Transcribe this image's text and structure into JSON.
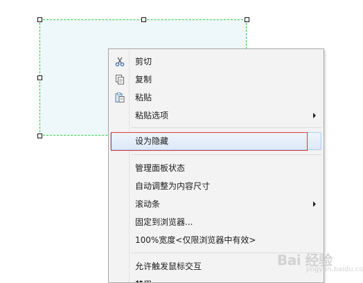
{
  "menu": {
    "items": [
      {
        "label": "剪切",
        "icon": "scissors-icon"
      },
      {
        "label": "复制",
        "icon": "copy-icon"
      },
      {
        "label": "粘贴",
        "icon": "paste-icon"
      },
      {
        "label": "粘贴选项",
        "submenu": true
      },
      {
        "label": "设为隐藏"
      },
      {
        "label": "管理面板状态"
      },
      {
        "label": "自动调整为内容尺寸"
      },
      {
        "label": "滚动条",
        "submenu": true
      },
      {
        "label": "固定到浏览器..."
      },
      {
        "label": "100%宽度<仅限浏览器中有效>"
      },
      {
        "label": "允许触发鼠标交互"
      },
      {
        "label": "禁用"
      }
    ]
  },
  "watermark": {
    "text": "Bai 经验",
    "sub": "jingyan.baidu.com"
  },
  "colors": {
    "panel_fill": "#eef7f9",
    "panel_border": "#2ecc40",
    "highlight_border": "#d93a3a",
    "menu_background": "#f3f3f3"
  }
}
